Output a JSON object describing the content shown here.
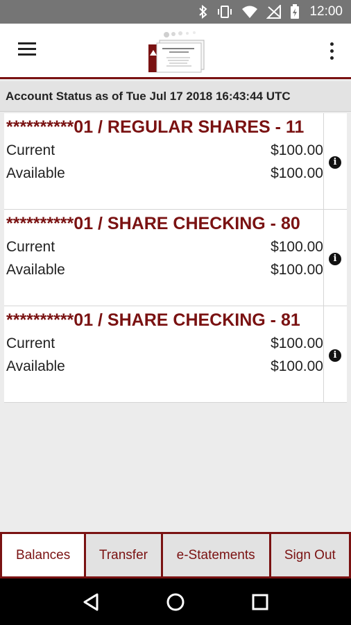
{
  "status_bar": {
    "time": "12:00"
  },
  "app_bar": {
    "menu_icon": "hamburger-menu-icon",
    "overflow_icon": "more-vert-icon"
  },
  "account_status": "Account Status as of Tue Jul 17 2018 16:43:44 UTC",
  "accounts": [
    {
      "title": "**********01 / REGULAR SHARES - 11",
      "current_label": "Current",
      "current_value": "$100.00",
      "available_label": "Available",
      "available_value": "$100.00"
    },
    {
      "title": "**********01 / SHARE CHECKING - 80",
      "current_label": "Current",
      "current_value": "$100.00",
      "available_label": "Available",
      "available_value": "$100.00"
    },
    {
      "title": "**********01 / SHARE CHECKING - 81",
      "current_label": "Current",
      "current_value": "$100.00",
      "available_label": "Available",
      "available_value": "$100.00"
    }
  ],
  "tabs": [
    {
      "label": "Balances",
      "active": true
    },
    {
      "label": "Transfer",
      "active": false
    },
    {
      "label": "e-Statements",
      "active": false
    },
    {
      "label": "Sign Out",
      "active": false
    }
  ],
  "colors": {
    "brand": "#7a1212",
    "status_bar": "#757575"
  }
}
